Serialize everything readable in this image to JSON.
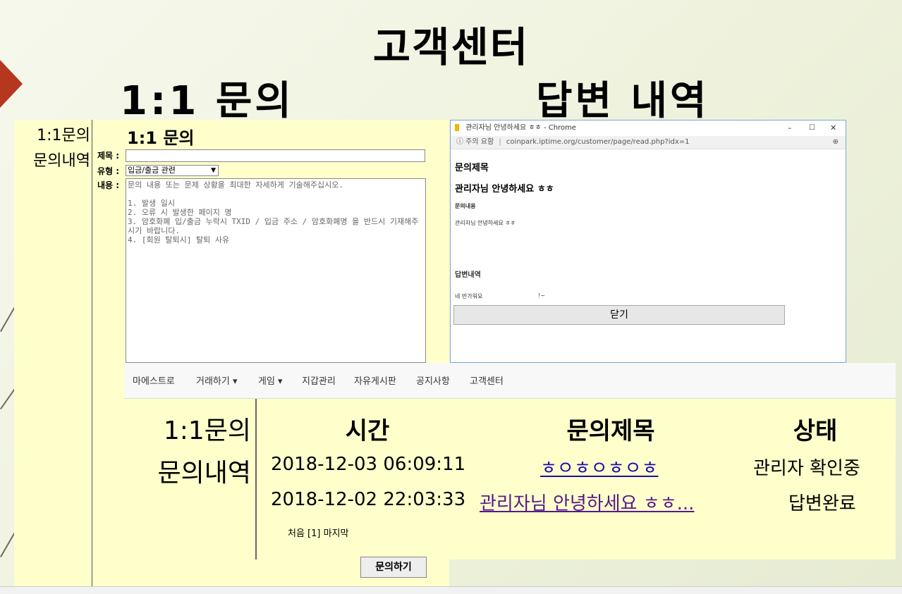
{
  "slide": {
    "title": "고객센터",
    "left_heading": "1:1 문의",
    "right_heading": "답변 내역"
  },
  "form": {
    "sidebar": [
      "1:1문의",
      "문의내역"
    ],
    "heading": "1:1 문의",
    "subject_label": "제목 :",
    "subject_value": "",
    "type_label": "유형 :",
    "type_value": "입금/출금 관련",
    "content_label": "내용 :",
    "content_placeholder": "문의 내용 또는 문제 상황을 최대한 자세하게 기술해주십시오.\n\n1. 발생 일시\n2. 오류 시 발생한 페이지 명\n3. 암호화폐 입/출금 누락시 TXID / 입금 주소 / 암호화폐명 을 반드시 기재해주시기 바랍니다.\n4. [회원 탈퇴시] 탈퇴 사유",
    "submit_label": "문의하기"
  },
  "popup": {
    "window_title": "관리자님 안녕하세요 ㅎㅎ - Chrome",
    "security_label": "ⓘ 주의 요함",
    "url": "coinpark.iptime.org/customer/page/read.php?idx=1",
    "section_subject": "문의제목",
    "subject": "관리자님 안녕하세요 ㅎㅎ",
    "section_content": "문의내용",
    "content": "관리자님 안녕하세요 ㅎㅎ",
    "section_answer": "답변내역",
    "answer": "네 반가워요",
    "answer_extra": "!~",
    "close_label": "닫기",
    "win_controls": [
      "–",
      "☐",
      "✕"
    ]
  },
  "nav": {
    "items": [
      "마에스트로",
      "거래하기 ▾",
      "게임 ▾",
      "지갑관리",
      "자유게시판",
      "공지사항",
      "고객센터"
    ]
  },
  "list": {
    "sidebar": [
      "1:1문의",
      "문의내역"
    ],
    "headers": [
      "시간",
      "문의제목",
      "상태"
    ],
    "rows": [
      {
        "time": "2018-12-03 06:09:11",
        "title": "ㅎㅇㅎㅇㅎㅇㅎ",
        "status": "관리자 확인중"
      },
      {
        "time": "2018-12-02 22:03:33",
        "title": "관리자님 안녕하세요 ㅎㅎ...",
        "status": "답변완료"
      }
    ],
    "pagination": "처음 [1] 마지막"
  },
  "colors": {
    "accent_red": "#b5371f",
    "panel_yellow": "#ffffcc",
    "link_blue": "#1a0dab",
    "link_visited": "#551a8b"
  }
}
